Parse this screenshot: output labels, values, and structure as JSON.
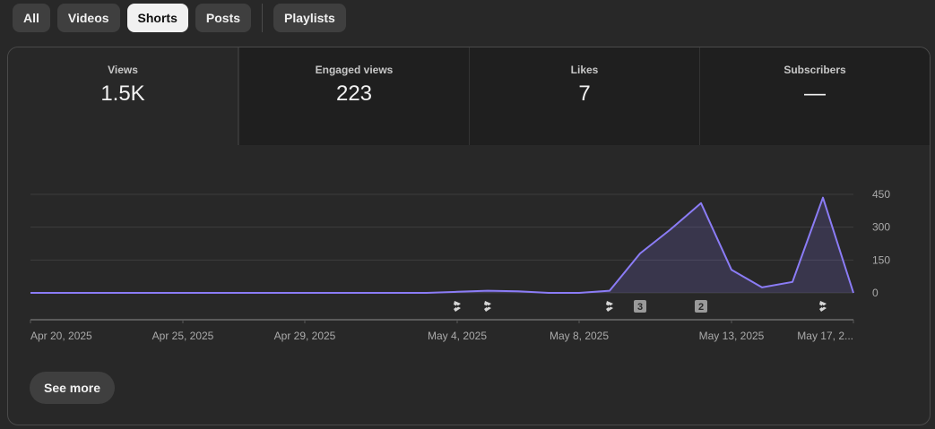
{
  "filters": {
    "chips": [
      "All",
      "Videos",
      "Shorts",
      "Posts",
      "Playlists"
    ],
    "active": "Shorts"
  },
  "metrics": [
    {
      "label": "Views",
      "value": "1.5K"
    },
    {
      "label": "Engaged views",
      "value": "223"
    },
    {
      "label": "Likes",
      "value": "7"
    },
    {
      "label": "Subscribers",
      "value": "—"
    }
  ],
  "chart_data": {
    "type": "area",
    "series": [
      {
        "values": [
          0,
          0,
          0,
          0,
          0,
          0,
          0,
          0,
          0,
          0,
          0,
          0,
          0,
          0,
          5,
          10,
          7,
          0,
          0,
          10,
          180,
          290,
          410,
          105,
          25,
          50,
          435,
          0
        ]
      }
    ],
    "x_labels": [
      "Apr 20, 2025",
      "Apr 25, 2025",
      "Apr 29, 2025",
      "May 4, 2025",
      "May 8, 2025",
      "May 13, 2025",
      "May 17, 2..."
    ],
    "y_ticks": [
      0,
      150,
      300,
      450
    ],
    "ylim": [
      0,
      450
    ],
    "line_color": "#8b7cf6",
    "upload_markers": [
      {
        "index": 14,
        "label": ""
      },
      {
        "index": 15,
        "label": ""
      },
      {
        "index": 19,
        "label": ""
      },
      {
        "index": 20,
        "label": "3"
      },
      {
        "index": 22,
        "label": "2"
      },
      {
        "index": 26,
        "label": ""
      }
    ]
  },
  "actions": {
    "see_more": "See more"
  }
}
